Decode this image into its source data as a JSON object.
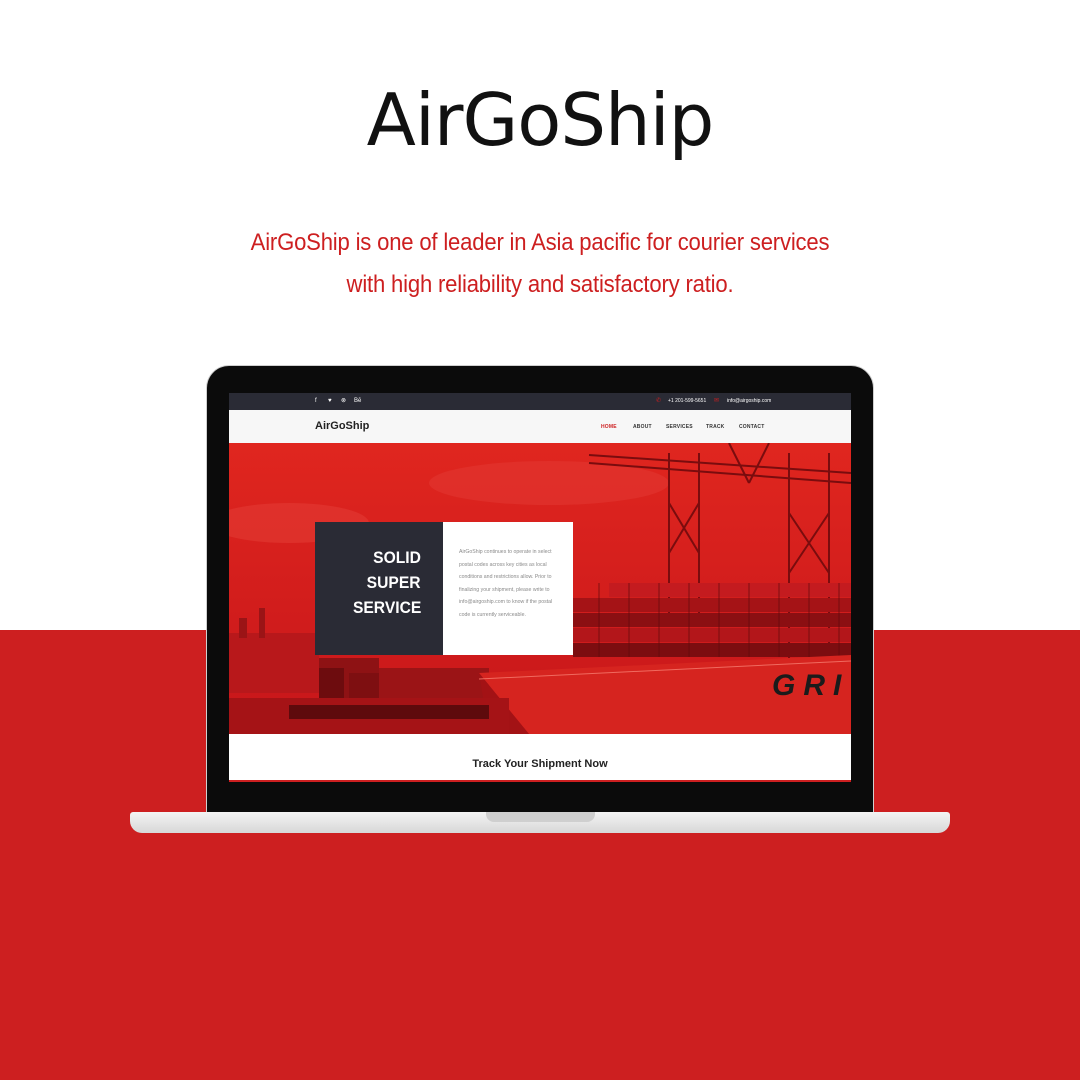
{
  "brand": {
    "title": "AirGoShip",
    "tagline_line1": "AirGoShip is one of leader in Asia pacific for courier services",
    "tagline_line2": "with high reliability and satisfactory ratio.",
    "accent_color": "#cd1f20"
  },
  "site": {
    "topbar": {
      "social_icons": [
        {
          "icon": "facebook-icon",
          "glyph": "f"
        },
        {
          "icon": "twitter-icon",
          "glyph": "♥"
        },
        {
          "icon": "pinterest-icon",
          "glyph": "⊗"
        },
        {
          "icon": "behance-icon",
          "glyph": "Bē"
        }
      ],
      "phone": "+1 201-599-5651",
      "email": "info@airgoship.com"
    },
    "nav": {
      "logo": "AirGoShip",
      "items": [
        "HOME",
        "ABOUT",
        "SERVICES",
        "TRACK",
        "CONTACT"
      ],
      "active": "HOME"
    },
    "hero": {
      "headline_lines": [
        "SOLID",
        "SUPER",
        "SERVICE"
      ],
      "body": "AirGoShip continues to operate in select postal codes across key cities as local conditions and restrictions allow. Prior to finalizing your shipment, please write to info@airgoship.com to know if the postal code is currently serviceable.",
      "ship_lettering": "GRI"
    },
    "track_heading": "Track Your Shipment Now"
  },
  "colors": {
    "dark_panel": "#2a2b35",
    "hero_red": "#d01a1d",
    "band_red": "#cd1f20"
  }
}
